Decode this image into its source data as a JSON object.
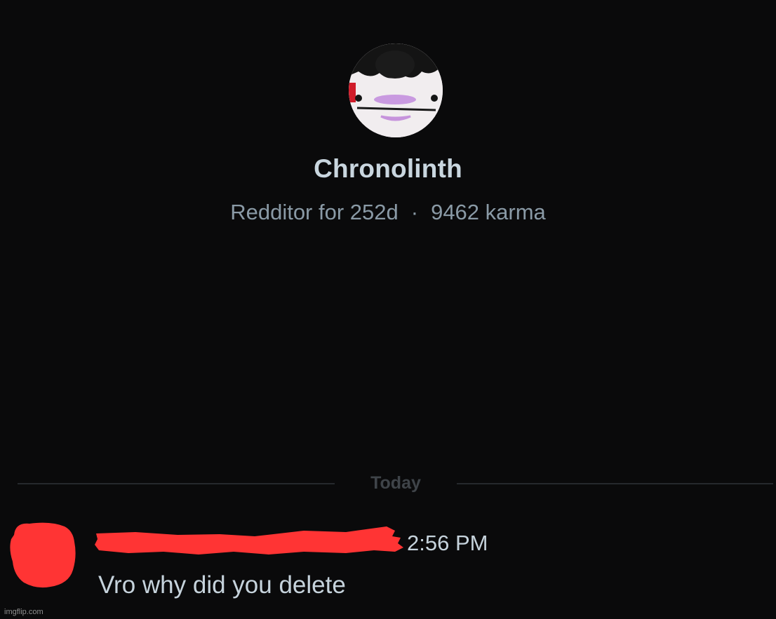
{
  "profile": {
    "avatar_icon": "cartoon-face-avatar",
    "username": "Chronolinth",
    "age_text": "Redditor for 252d",
    "separator": "·",
    "karma_text": "9462 karma"
  },
  "divider": {
    "label": "Today"
  },
  "message": {
    "sender_redacted": true,
    "redaction_color": "#ff3434",
    "time": "2:56 PM",
    "text": "Vro why did you delete"
  },
  "watermark": "imgflip.com",
  "colors": {
    "background": "#0a0a0b",
    "username": "#c9d6df",
    "meta": "#8a9aa6",
    "divider_label": "#3f4449",
    "message_text": "#c6d3dc"
  }
}
